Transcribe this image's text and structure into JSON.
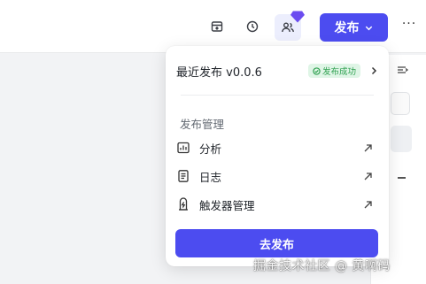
{
  "toolbar": {
    "publish_label": "发布",
    "more_label": "···",
    "icons": [
      "archive-icon",
      "history-icon",
      "collaborators-icon"
    ]
  },
  "dropdown": {
    "recent_label": "最近发布 v0.0.6",
    "status_label": "发布成功",
    "section_title": "发布管理",
    "items": [
      {
        "label": "分析",
        "icon": "analytics-icon"
      },
      {
        "label": "日志",
        "icon": "log-icon"
      },
      {
        "label": "触发器管理",
        "icon": "trigger-icon"
      }
    ],
    "go_publish_label": "去发布"
  },
  "watermark": "掘金技术社区 @ 黄啊码",
  "colors": {
    "accent": "#4c4cf0",
    "success": "#2ea04f",
    "success_bg": "#dff5e6"
  }
}
